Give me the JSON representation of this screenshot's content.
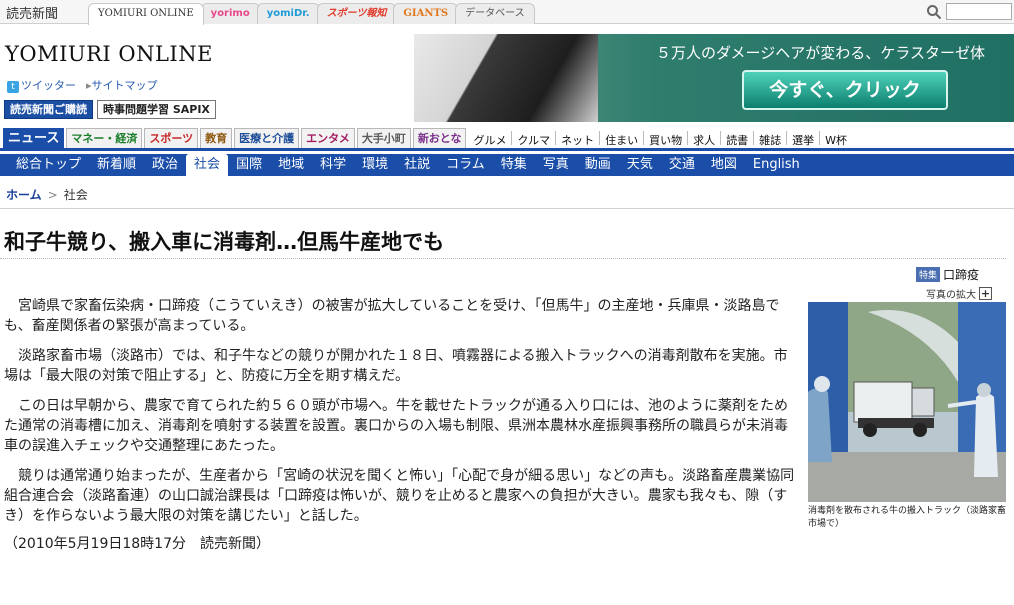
{
  "site": {
    "paper_name": "読売新聞",
    "tabs": [
      "YOMIURI ONLINE",
      "yorimo",
      "yomiDr.",
      "スポーツ報知",
      "GIANTS",
      "データベース"
    ]
  },
  "header": {
    "logo": "YOMIURI ONLINE",
    "twitter": "ツイッター",
    "sitemap": "サイトマップ",
    "subscribe": "読売新聞ご購読",
    "sapix": "時事問題学習 SAPIX"
  },
  "ad": {
    "text": "５万人のダメージヘアが変わる、ケラスターゼ体",
    "button": "今すぐ、クリック"
  },
  "categories": [
    "ニュース",
    "マネー・経済",
    "スポーツ",
    "教育",
    "医療と介護",
    "エンタメ",
    "大手小町",
    "新おとな"
  ],
  "minor_links": [
    "グルメ",
    "クルマ",
    "ネット",
    "住まい",
    "買い物",
    "求人",
    "読書",
    "雑誌",
    "選挙",
    "W杯"
  ],
  "subnav": [
    "総合トップ",
    "新着順",
    "政治",
    "社会",
    "国際",
    "地域",
    "科学",
    "環境",
    "社説",
    "コラム",
    "特集",
    "写真",
    "動画",
    "天気",
    "交通",
    "地図",
    "English"
  ],
  "breadcrumb": {
    "home": "ホーム",
    "current": "社会"
  },
  "article": {
    "headline": "和子牛競り、搬入車に消毒剤…但馬牛産地でも",
    "tag_badge": "特集",
    "tag_keyword": "口蹄疫",
    "paragraphs": [
      "宮崎県で家畜伝染病・口蹄疫（こうていえき）の被害が拡大していることを受け、「但馬牛」の主産地・兵庫県・淡路島でも、畜産関係者の緊張が高まっている。",
      "淡路家畜市場（淡路市）では、和子牛などの競りが開かれた１８日、噴霧器による搬入トラックへの消毒剤散布を実施。市場は「最大限の対策で阻止する」と、防疫に万全を期す構えだ。",
      "この日は早朝から、農家で育てられた約５６０頭が市場へ。牛を載せたトラックが通る入り口には、池のように薬剤をためた通常の消毒槽に加え、消毒剤を噴射する装置を設置。裏口からの入場も制限、県洲本農林水産振興事務所の職員らが未消毒車の誤進入チェックや交通整理にあたった。",
      "競りは通常通り始まったが、生産者から「宮崎の状況を聞くと怖い」「心配で身が細る思い」などの声も。淡路畜産農業協同組合連合会（淡路畜連）の山口誠治課長は「口蹄疫は怖いが、競りを止めると農家への負担が大きい。農家も我々も、隙（すき）を作らないよう最大限の対策を講じたい」と話した。"
    ],
    "dateline": "（2010年5月19日18時17分　読売新聞）"
  },
  "photo": {
    "zoom_label": "写真の拡大",
    "caption": "消毒剤を散布される牛の搬入トラック（淡路家畜市場で）"
  },
  "colors": {
    "brand_blue": "#1b4ea8",
    "link": "#1a3f98"
  }
}
